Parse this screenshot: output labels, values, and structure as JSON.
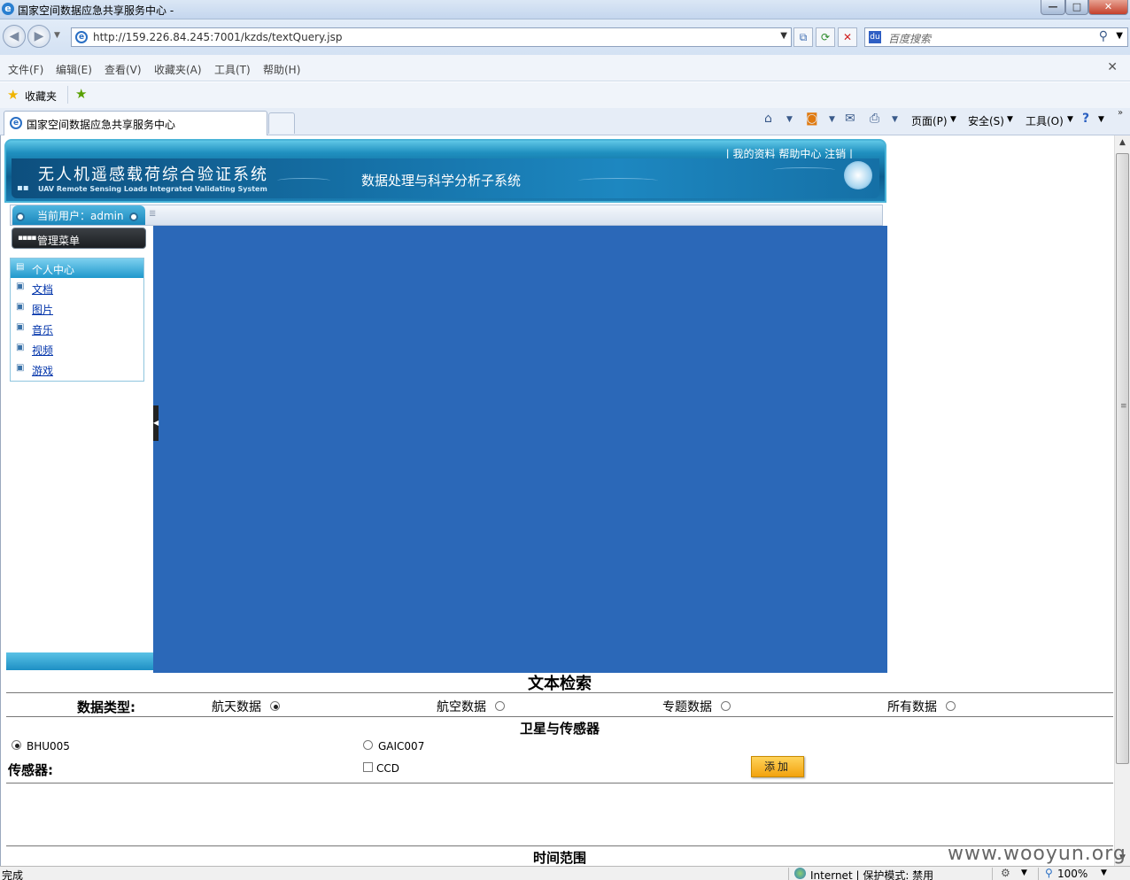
{
  "window": {
    "title": "国家空间数据应急共享服务中心 -",
    "minimize": "—",
    "maximize": "□",
    "close": "✕"
  },
  "address": {
    "url": "http://159.226.84.245:7001/kzds/textQuery.jsp",
    "search_placeholder": "百度搜索"
  },
  "menu": [
    "文件(F)",
    "编辑(E)",
    "查看(V)",
    "收藏夹(A)",
    "工具(T)",
    "帮助(H)"
  ],
  "favorites": {
    "label": "收藏夹"
  },
  "tab": {
    "title": "国家空间数据应急共享服务中心"
  },
  "commandbar": {
    "page": "页面(P)",
    "safety": "安全(S)",
    "tools": "工具(O)"
  },
  "banner": {
    "links": "| 我的资料  帮助中心  注销 |",
    "system_title": "无人机遥感载荷综合验证系统",
    "system_subtitle": "UAV Remote Sensing Loads Integrated Validating System",
    "subsystem": "数据处理与科学分析子系统"
  },
  "user": {
    "label": "当前用户：admin"
  },
  "sidebar": {
    "menu_title": "管理菜单",
    "section": "个人中心",
    "items": [
      {
        "label": "文档"
      },
      {
        "label": "图片"
      },
      {
        "label": "音乐"
      },
      {
        "label": "视频"
      },
      {
        "label": "游戏"
      }
    ]
  },
  "form": {
    "title": "文本检索",
    "data_type_label": "数据类型:",
    "data_types": [
      {
        "label": "航天数据",
        "selected": true
      },
      {
        "label": "航空数据",
        "selected": false
      },
      {
        "label": "专题数据",
        "selected": false
      },
      {
        "label": "所有数据",
        "selected": false
      }
    ],
    "satellite_section": "卫星与传感器",
    "satellites": [
      {
        "label": "BHU005",
        "selected": true
      },
      {
        "label": "GAIC007",
        "selected": false
      }
    ],
    "sensor_label": "传感器:",
    "sensors": [
      {
        "label": "CCD",
        "checked": false
      }
    ],
    "add_button": "添加",
    "time_range": "时间范围"
  },
  "status": {
    "text": "完成",
    "zone": "Internet | 保护模式: 禁用",
    "zoom": "100%"
  },
  "watermark": "www.wooyun.org"
}
